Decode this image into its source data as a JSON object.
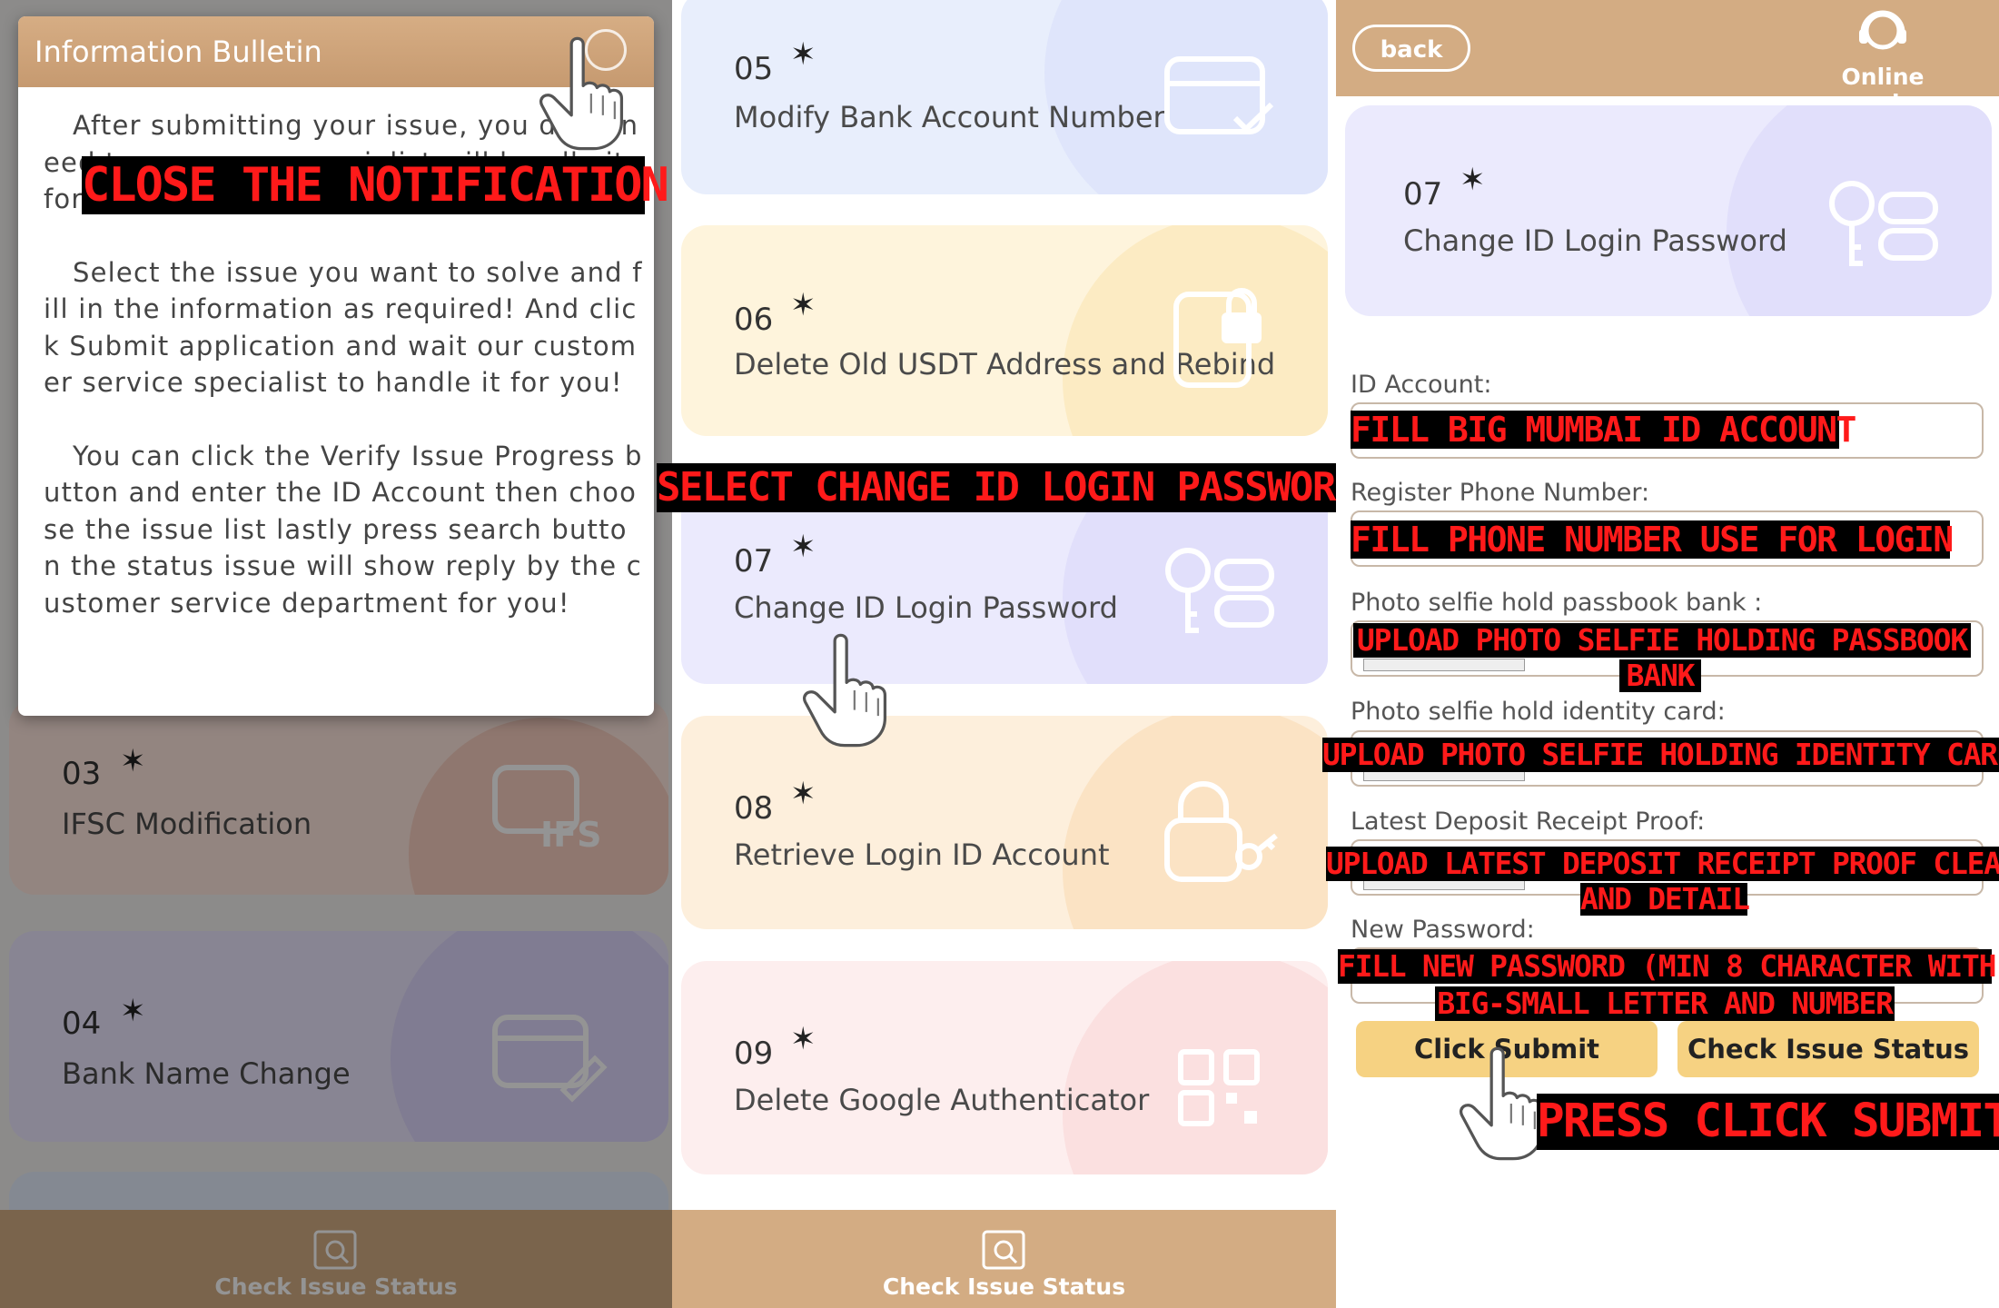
{
  "colors": {
    "accent": "#d3ac83",
    "button": "#f6d282",
    "overlay_text": "#ff1a1a",
    "overlay_bg": "#000000"
  },
  "left": {
    "modal_title": "Information Bulletin",
    "paragraphs": [
      "After submitting your issue, you don't need to worry, our specialist will handle it for you.",
      "Select the issue you want to solve and fill in the information as required! And click Submit application and wait our customer service specialist to handle it for you!",
      "You can click the Verify Issue Progress button and enter the ID Account then choose the issue list lastly press search button the status issue will show reply by the customer service department for you!"
    ],
    "cards": [
      {
        "num": "03",
        "title": "IFSC Modification",
        "icon": "ifsc-icon"
      },
      {
        "num": "04",
        "title": "Bank Name Change",
        "icon": "card-edit-icon"
      }
    ],
    "tab_label": "Check Issue Status",
    "instruction": "CLOSE THE NOTIFICATION"
  },
  "middle": {
    "cards": [
      {
        "num": "05",
        "title": "Modify Bank Account Number",
        "icon": "card-check-icon"
      },
      {
        "num": "06",
        "title": "Delete Old USDT Address and Rebind",
        "icon": "lock-screen-icon"
      },
      {
        "num": "07",
        "title": "Change ID Login Password",
        "icon": "key-icon"
      },
      {
        "num": "08",
        "title": "Retrieve Login ID Account",
        "icon": "lock-key-icon"
      },
      {
        "num": "09",
        "title": "Delete Google Authenticator",
        "icon": "qr-code-icon"
      }
    ],
    "tab_label": "Check Issue Status",
    "instruction": "SELECT CHANGE ID LOGIN PASSWORD"
  },
  "right": {
    "back_label": "back",
    "service_label": "Online service",
    "card": {
      "num": "07",
      "title": "Change ID Login Password",
      "icon": "key-icon"
    },
    "fields": [
      {
        "label": "ID Account:",
        "instruction": "FILL BIG MUMBAI ID ACCOUNT"
      },
      {
        "label": "Register Phone Number:",
        "instruction": "FILL PHONE NUMBER USE FOR LOGIN"
      },
      {
        "label": "Photo selfie hold passbook bank :",
        "instruction1": "UPLOAD PHOTO SELFIE HOLDING PASSBOOK",
        "instruction2": "BANK"
      },
      {
        "label": "Photo selfie hold identity card:",
        "instruction": "UPLOAD PHOTO SELFIE HOLDING IDENTITY CARD"
      },
      {
        "label": "Latest Deposit Receipt Proof:",
        "instruction1": "UPLOAD LATEST DEPOSIT RECEIPT PROOF CLEAR",
        "instruction2": "AND DETAIL"
      },
      {
        "label": "New Password:",
        "instruction1": "FILL NEW PASSWORD (MIN 8 CHARACTER WITH",
        "instruction2": "BIG-SMALL LETTER AND NUMBER"
      }
    ],
    "submit_label": "Click Submit",
    "check_label": "Check Issue Status",
    "instruction": "PRESS CLICK SUBMIT"
  }
}
